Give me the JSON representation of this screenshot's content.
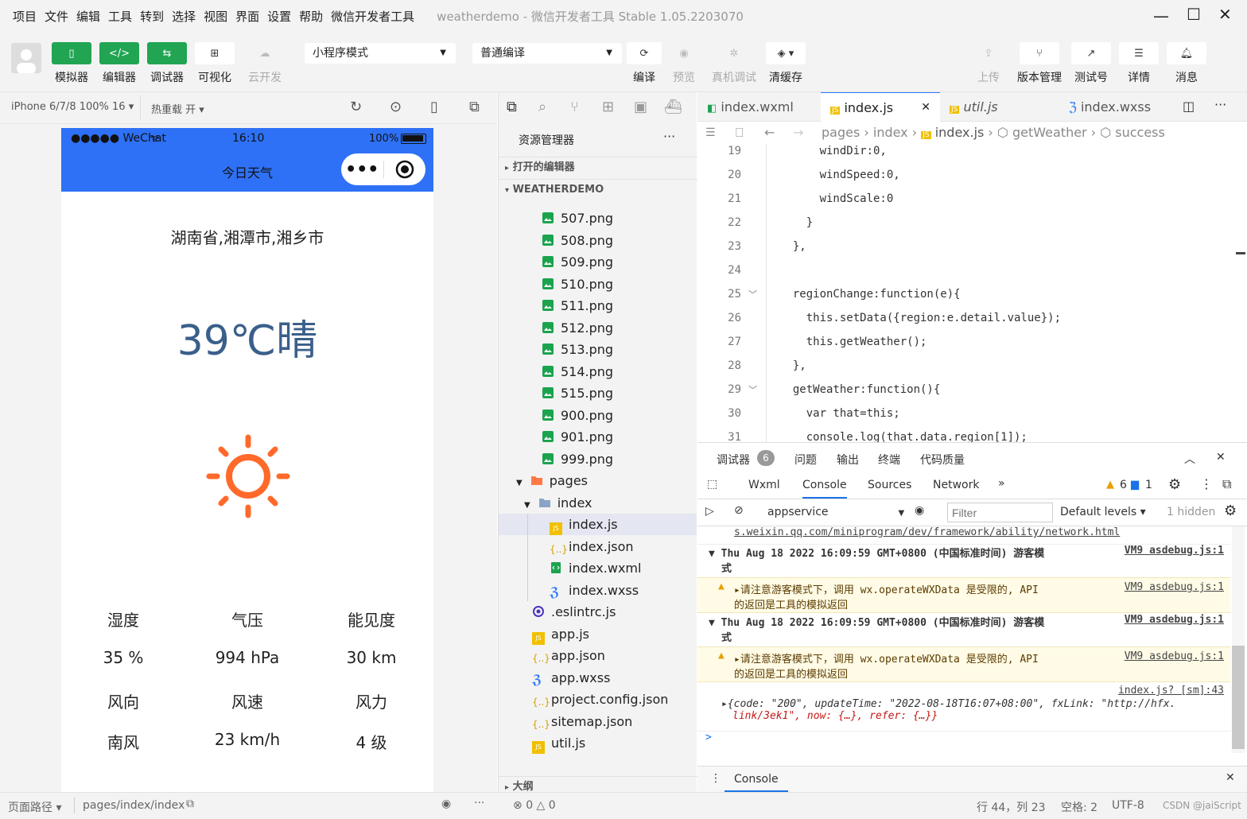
{
  "menu": [
    "项目",
    "文件",
    "编辑",
    "工具",
    "转到",
    "选择",
    "视图",
    "界面",
    "设置",
    "帮助",
    "微信开发者工具"
  ],
  "app_title": "weatherdemo",
  "app_subtitle": "- 微信开发者工具 Stable 1.05.2203070",
  "toolbar": {
    "simulator": "模拟器",
    "editor": "编辑器",
    "debugger": "调试器",
    "visual": "可视化",
    "cloud": "云开发",
    "mode_select": "小程序模式",
    "compile_select": "普通编译",
    "compile": "编译",
    "preview": "预览",
    "remote_debug": "真机调试",
    "clear_cache": "清缓存",
    "upload": "上传",
    "version": "版本管理",
    "test": "测试号",
    "details": "详情",
    "messages": "消息"
  },
  "sim": {
    "device": "iPhone 6/7/8 100% 16 ▾",
    "hot_reload": "热重载 开 ▾",
    "carrier": "●●●●● WeChat",
    "time": "16:10",
    "battery": "100%",
    "nav_title": "今日天气",
    "location": "湖南省,湘潭市,湘乡市",
    "temperature": "39℃晴",
    "labels1": [
      "湿度",
      "气压",
      "能见度"
    ],
    "values1": [
      "35 %",
      "994 hPa",
      "30 km"
    ],
    "labels2": [
      "风向",
      "风速",
      "风力"
    ],
    "values2": [
      "南风",
      "23 km/h",
      "4 级"
    ]
  },
  "explorer": {
    "title": "资源管理器",
    "open_editors": "打开的编辑器",
    "project": "WEATHERDEMO",
    "outline": "大纲",
    "images": [
      "507.png",
      "508.png",
      "509.png",
      "510.png",
      "511.png",
      "512.png",
      "513.png",
      "514.png",
      "515.png",
      "900.png",
      "901.png",
      "999.png"
    ],
    "pages": "pages",
    "index_folder": "index",
    "index_files": [
      "index.js",
      "index.json",
      "index.wxml",
      "index.wxss"
    ],
    "root_files": [
      ".eslintrc.js",
      "app.js",
      "app.json",
      "app.wxss",
      "project.config.json",
      "sitemap.json",
      "util.js"
    ]
  },
  "tabs": [
    "index.wxml",
    "index.js",
    "util.js",
    "index.wxss"
  ],
  "breadcrumb": [
    "pages",
    "index",
    "index.js",
    "getWeather",
    "success"
  ],
  "code": {
    "line_numbers": [
      "19",
      "20",
      "21",
      "22",
      "23",
      "24",
      "25",
      "26",
      "27",
      "28",
      "29",
      "30",
      "31"
    ],
    "lines": [
      "      windDir:0,",
      "      windSpeed:0,",
      "      windScale:0",
      "    }",
      "  },",
      "",
      "  regionChange:function(e){",
      "    this.setData({region:e.detail.value});",
      "    this.getWeather();",
      "  },",
      "  getWeather:function(){",
      "    var that=this;",
      "    console.log(that.data.region[1]);"
    ]
  },
  "debugger": {
    "top_tabs": [
      "调试器",
      "问题",
      "输出",
      "终端",
      "代码质量"
    ],
    "badge": "6",
    "tabs": [
      "Wxml",
      "Console",
      "Sources",
      "Network"
    ],
    "warn_count": "6",
    "info_count": "1",
    "context": "appservice",
    "filter_placeholder": "Filter",
    "levels": "Default levels ▾",
    "hidden": "1 hidden",
    "log_url": "s.weixin.qq.com/miniprogram/dev/framework/ability/network.html",
    "group1": "▼ Thu Aug 18 2022 16:09:59 GMT+0800 (中国标准时间) 游客模",
    "group1b": "式",
    "warn1": "▸请注意游客模式下，调用 wx.operateWXData 是受限的, API",
    "warn1b": "的返回是工具的模拟返回",
    "src": "VM9 asdebug.js:1",
    "src2": "index.js? [sm]:43",
    "obj1": "▸{code: \"200\", updateTime: \"2022-08-18T16:07+08:00\", fxLink: \"http://hfx.",
    "obj2": "link/3ek1\", now: {…}, refer: {…}}",
    "prompt": ">",
    "drawer": "Console"
  },
  "statusbar": {
    "page_path_label": "页面路径 ▾",
    "page_path": "pages/index/index",
    "errors": "0",
    "warnings": "0",
    "position": "行 44，列 23",
    "spaces": "空格: 2",
    "encoding": "UTF-8",
    "watermark": "CSDN @jaiScript"
  },
  "colors": {
    "accent_green": "#21a553",
    "nav_blue": "#2e71f6",
    "sun": "#ff6a2b",
    "temp": "#3a5f8a"
  }
}
